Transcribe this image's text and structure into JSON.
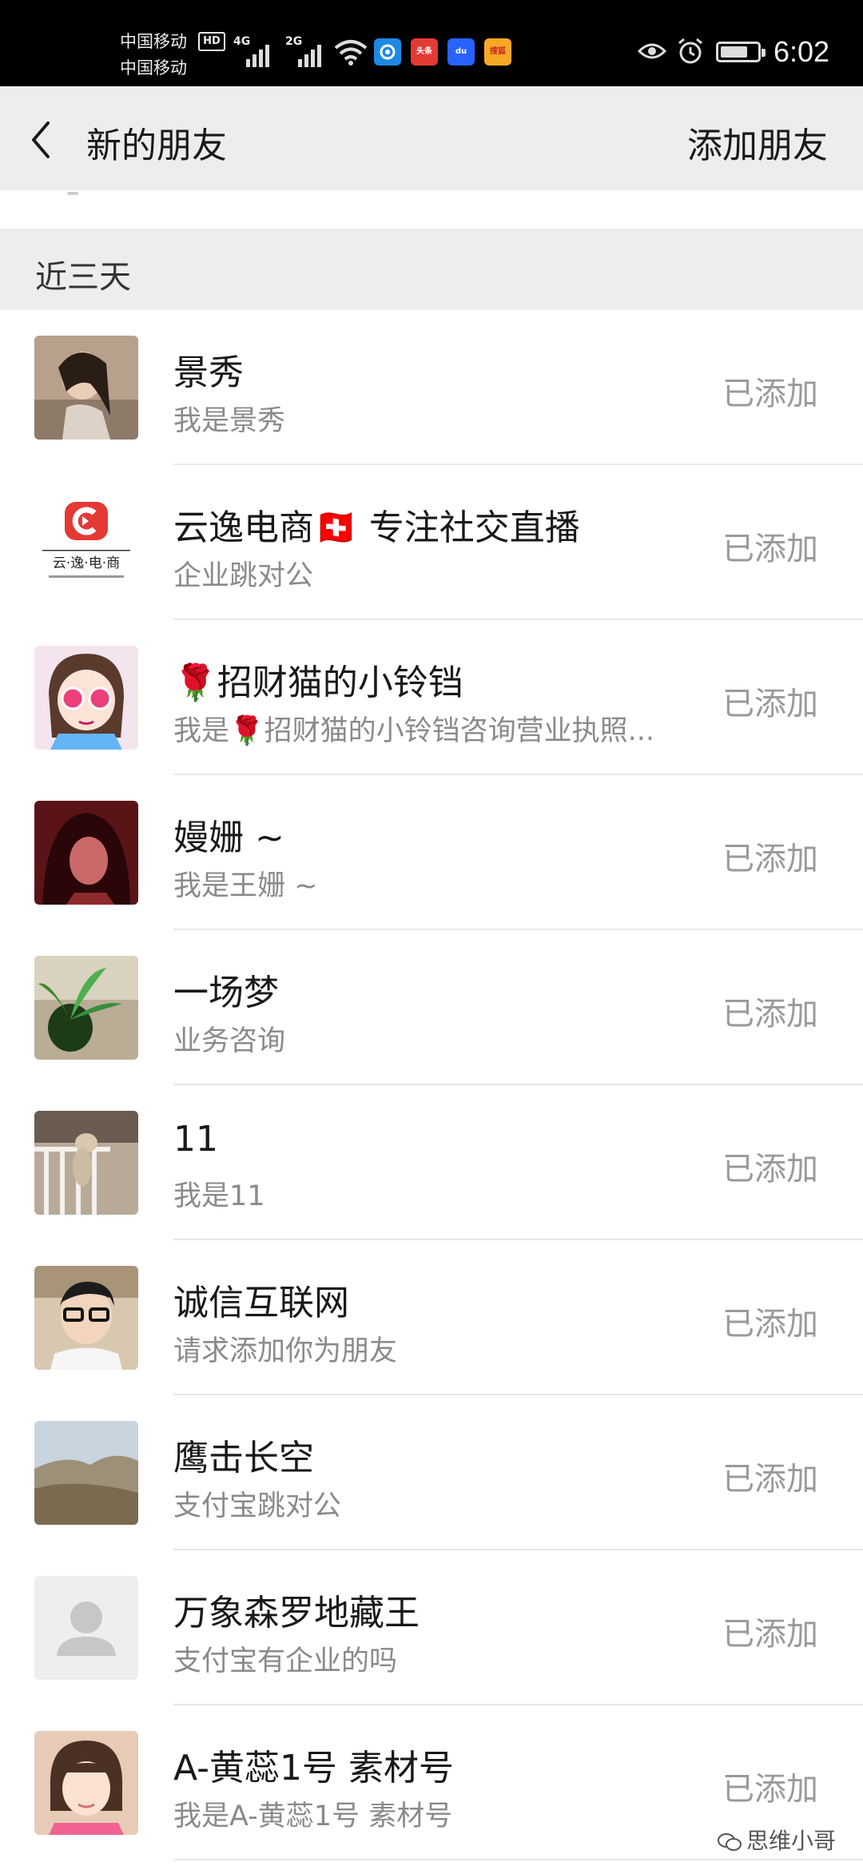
{
  "status_bar": {
    "carrier_1": "中国移动",
    "carrier_2": "中国移动",
    "hd_badge": "HD",
    "signal_1_label": "4G",
    "signal_2_label": "2G",
    "time": "6:02",
    "app_icons": [
      {
        "name": "wifi-key-icon",
        "color": "#1e88e5",
        "label": ""
      },
      {
        "name": "toutiao-icon",
        "color": "#e53935",
        "label": "头条"
      },
      {
        "name": "baidu-icon",
        "color": "#2962ff",
        "label": "du"
      },
      {
        "name": "sohu-icon",
        "color": "#f9a825",
        "label": "搜狐"
      }
    ]
  },
  "header": {
    "title": "新的朋友",
    "action": "添加朋友"
  },
  "section": {
    "title": "近三天"
  },
  "friends": [
    {
      "name": "景秀",
      "message": "我是景秀",
      "status": "已添加",
      "avatar": "photo-girl-avatar",
      "avatar_bg": "#b7a08c"
    },
    {
      "name": "云逸电商🇨🇭 专注社交直播",
      "message": "企业跳对公",
      "status": "已添加",
      "avatar": "yunyi-logo-avatar",
      "avatar_bg": "#ffffff",
      "logo_text": "云·逸·电·商"
    },
    {
      "name": "🌹招财猫的小铃铛",
      "message": "我是🌹招财猫的小铃铛咨询营业执照...",
      "status": "已添加",
      "avatar": "cartoon-girl-avatar",
      "avatar_bg": "#f3e4ee"
    },
    {
      "name": "嫚姗 ~",
      "message": "我是王姗 ~",
      "status": "已添加",
      "avatar": "illustration-avatar",
      "avatar_bg": "#5a1418"
    },
    {
      "name": "一场梦",
      "message": "业务咨询",
      "status": "已添加",
      "avatar": "plant-avatar",
      "avatar_bg": "#8a9a6a"
    },
    {
      "name": "11",
      "message": "我是11",
      "status": "已添加",
      "avatar": "cat-avatar",
      "avatar_bg": "#b8aa98"
    },
    {
      "name": "诚信互联网",
      "message": "请求添加你为朋友",
      "status": "已添加",
      "avatar": "boy-glasses-avatar",
      "avatar_bg": "#d8c8b0"
    },
    {
      "name": "鹰击长空",
      "message": "支付宝跳对公",
      "status": "已添加",
      "avatar": "mountain-avatar",
      "avatar_bg": "#8b8470"
    },
    {
      "name": "万象森罗地藏王",
      "message": "支付宝有企业的吗",
      "status": "已添加",
      "avatar": "default-person-avatar",
      "avatar_bg": "#eeeeee"
    },
    {
      "name": "A-黄蕊1号 素材号",
      "message": "我是A-黄蕊1号 素材号",
      "status": "已添加",
      "avatar": "child-avatar",
      "avatar_bg": "#e7cbb6"
    }
  ],
  "watermark": "思维小哥"
}
